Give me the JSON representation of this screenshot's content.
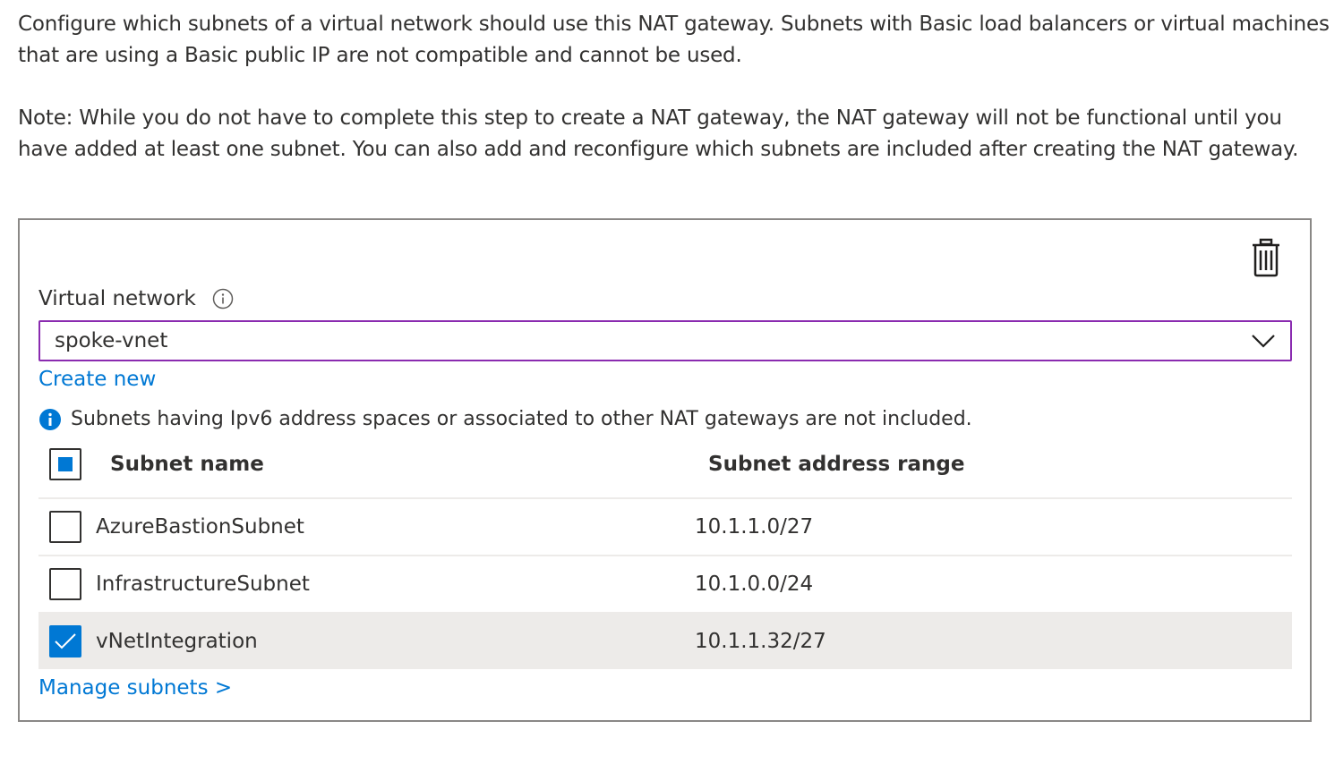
{
  "intro": {
    "paragraph1": "Configure which subnets of a virtual network should use this NAT gateway. Subnets with Basic load balancers or virtual machines that are using a Basic public IP are not compatible and cannot be used.",
    "paragraph2": "Note: While you do not have to complete this step to create a NAT gateway, the NAT gateway will not be functional until you have added at least one subnet. You can also add and reconfigure which subnets are included after creating the NAT gateway."
  },
  "panel": {
    "delete_icon": "trash-icon",
    "virtual_network_label": "Virtual network",
    "info_icon": "info-outline-icon",
    "virtual_network_value": "spoke-vnet",
    "create_new_link": "Create new",
    "info_message": "Subnets having Ipv6 address spaces or associated to other NAT gateways are not included.",
    "manage_subnets_link": "Manage subnets >"
  },
  "table": {
    "columns": [
      "Subnet name",
      "Subnet address range"
    ],
    "select_all_state": "partial",
    "rows": [
      {
        "name": "AzureBastionSubnet",
        "range": "10.1.1.0/27",
        "checked": false
      },
      {
        "name": "InfrastructureSubnet",
        "range": "10.1.0.0/24",
        "checked": false
      },
      {
        "name": "vNetIntegration",
        "range": "10.1.1.32/27",
        "checked": true
      }
    ]
  },
  "colors": {
    "accent": "#0078d4",
    "focus_border": "#8a2bb0",
    "text": "#323130",
    "selected_row_bg": "#edebe9",
    "panel_border": "#8a8886"
  }
}
